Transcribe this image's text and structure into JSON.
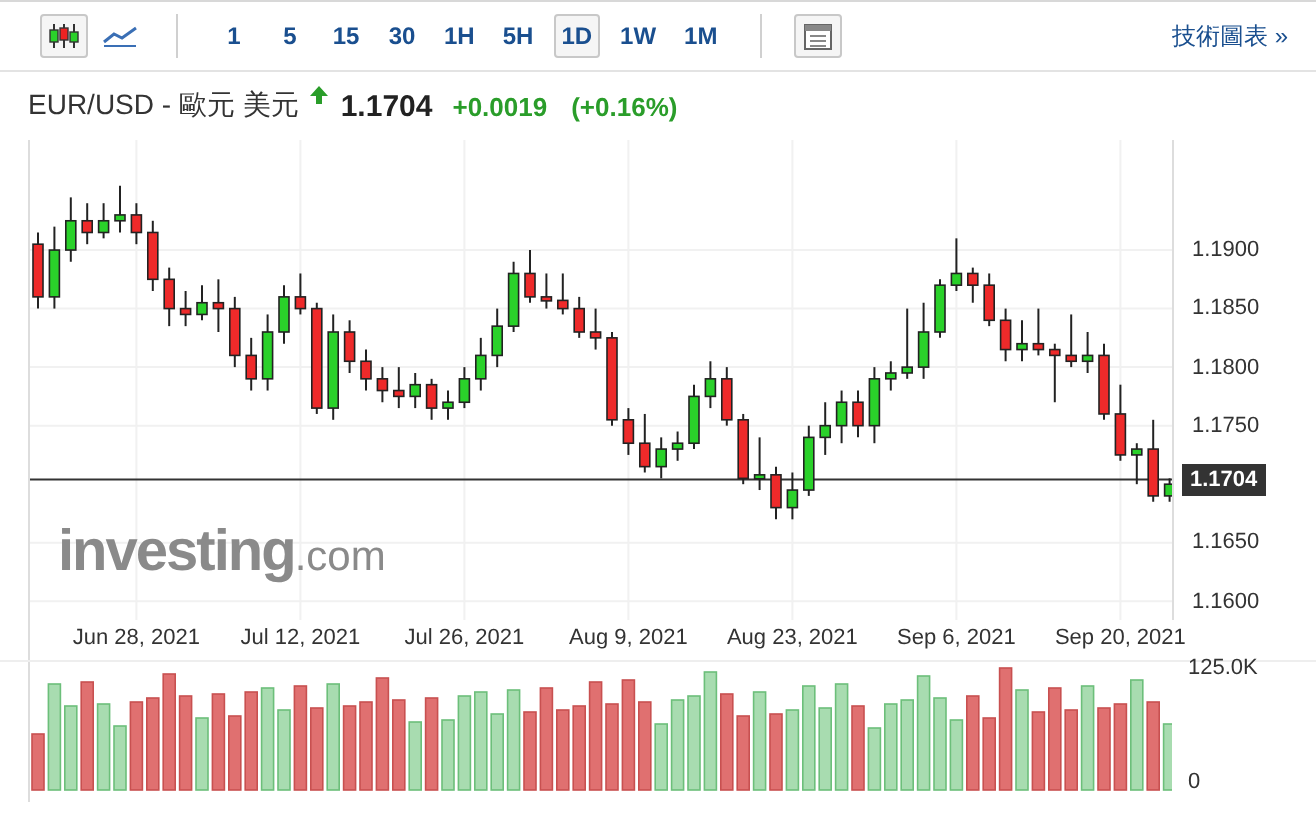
{
  "toolbar": {
    "chart_types": [
      {
        "kind": "candlestick",
        "selected": true
      },
      {
        "kind": "line",
        "selected": false
      }
    ],
    "intervals": [
      {
        "label": "1",
        "selected": false
      },
      {
        "label": "5",
        "selected": false
      },
      {
        "label": "15",
        "selected": false
      },
      {
        "label": "30",
        "selected": false
      },
      {
        "label": "1H",
        "selected": false
      },
      {
        "label": "5H",
        "selected": false
      },
      {
        "label": "1D",
        "selected": true
      },
      {
        "label": "1W",
        "selected": false
      },
      {
        "label": "1M",
        "selected": false
      }
    ],
    "link": "技術圖表 »"
  },
  "header": {
    "symbol": "EUR/USD - 歐元 美元",
    "up": true,
    "price": "1.1704",
    "change": "+0.0019",
    "change_percent": "(+0.16%)"
  },
  "chart": {
    "logo": {
      "name": "investing",
      "suffix": ".com"
    },
    "volume_labels": {
      "max": "125.0K",
      "min": "0"
    },
    "chart_data": {
      "type": "candlestick",
      "categories": [
        null,
        null,
        null,
        null,
        null,
        null,
        "Jun 28, 2021",
        null,
        null,
        null,
        null,
        null,
        null,
        null,
        null,
        null,
        "Jul 12, 2021",
        null,
        null,
        null,
        null,
        null,
        null,
        null,
        null,
        null,
        "Jul 26, 2021",
        null,
        null,
        null,
        null,
        null,
        null,
        null,
        null,
        null,
        "Aug 9, 2021",
        null,
        null,
        null,
        null,
        null,
        null,
        null,
        null,
        null,
        "Aug 23, 2021",
        null,
        null,
        null,
        null,
        null,
        null,
        null,
        null,
        null,
        "Sep 6, 2021",
        null,
        null,
        null,
        null,
        null,
        null,
        null,
        null,
        null,
        "Sep 20, 2021",
        null,
        null,
        null
      ],
      "ylim": [
        1.1584,
        1.1994
      ],
      "grid": true,
      "ref_lines": [
        {
          "axis": "y",
          "value": 1.1704,
          "label": "1.1704"
        }
      ],
      "yticks": [
        {
          "value": 1.19,
          "label": "1.1900"
        },
        {
          "value": 1.185,
          "label": "1.1850"
        },
        {
          "value": 1.18,
          "label": "1.1800"
        },
        {
          "value": 1.175,
          "label": "1.1750"
        },
        {
          "value": 1.165,
          "label": "1.1650"
        },
        {
          "value": 1.16,
          "label": "1.1600"
        }
      ],
      "ohlc": [
        [
          1.1905,
          1.1915,
          1.185,
          1.186
        ],
        [
          1.186,
          1.192,
          1.185,
          1.19
        ],
        [
          1.19,
          1.1945,
          1.189,
          1.1925
        ],
        [
          1.1925,
          1.194,
          1.1905,
          1.1915
        ],
        [
          1.1915,
          1.194,
          1.191,
          1.1925
        ],
        [
          1.1925,
          1.1955,
          1.1915,
          1.193
        ],
        [
          1.193,
          1.194,
          1.1905,
          1.1915
        ],
        [
          1.1915,
          1.1925,
          1.1865,
          1.1875
        ],
        [
          1.1875,
          1.1885,
          1.1835,
          1.185
        ],
        [
          1.185,
          1.1865,
          1.1835,
          1.1845
        ],
        [
          1.1845,
          1.187,
          1.184,
          1.1855
        ],
        [
          1.1855,
          1.1875,
          1.183,
          1.185
        ],
        [
          1.185,
          1.186,
          1.18,
          1.181
        ],
        [
          1.181,
          1.1825,
          1.178,
          1.179
        ],
        [
          1.179,
          1.1845,
          1.178,
          1.183
        ],
        [
          1.183,
          1.187,
          1.182,
          1.186
        ],
        [
          1.186,
          1.188,
          1.1845,
          1.185
        ],
        [
          1.185,
          1.1855,
          1.176,
          1.1765
        ],
        [
          1.1765,
          1.1845,
          1.1755,
          1.183
        ],
        [
          1.183,
          1.184,
          1.1795,
          1.1805
        ],
        [
          1.1805,
          1.1815,
          1.178,
          1.179
        ],
        [
          1.179,
          1.18,
          1.177,
          1.178
        ],
        [
          1.178,
          1.18,
          1.1765,
          1.1775
        ],
        [
          1.1775,
          1.1795,
          1.1765,
          1.1785
        ],
        [
          1.1785,
          1.179,
          1.1755,
          1.1765
        ],
        [
          1.1765,
          1.178,
          1.1755,
          1.177
        ],
        [
          1.177,
          1.18,
          1.1765,
          1.179
        ],
        [
          1.179,
          1.1825,
          1.178,
          1.181
        ],
        [
          1.181,
          1.185,
          1.18,
          1.1835
        ],
        [
          1.1835,
          1.189,
          1.183,
          1.188
        ],
        [
          1.188,
          1.19,
          1.1855,
          1.186
        ],
        [
          1.186,
          1.188,
          1.185,
          1.1857
        ],
        [
          1.1857,
          1.188,
          1.1845,
          1.185
        ],
        [
          1.185,
          1.186,
          1.1825,
          1.183
        ],
        [
          1.183,
          1.185,
          1.1815,
          1.1825
        ],
        [
          1.1825,
          1.183,
          1.175,
          1.1755
        ],
        [
          1.1755,
          1.1765,
          1.1725,
          1.1735
        ],
        [
          1.1735,
          1.176,
          1.171,
          1.1715
        ],
        [
          1.1715,
          1.174,
          1.1705,
          1.173
        ],
        [
          1.173,
          1.1745,
          1.172,
          1.1735
        ],
        [
          1.1735,
          1.1785,
          1.173,
          1.1775
        ],
        [
          1.1775,
          1.1805,
          1.1765,
          1.179
        ],
        [
          1.179,
          1.18,
          1.175,
          1.1755
        ],
        [
          1.1755,
          1.176,
          1.17,
          1.1705
        ],
        [
          1.1705,
          1.174,
          1.1695,
          1.1708
        ],
        [
          1.1708,
          1.1715,
          1.167,
          1.168
        ],
        [
          1.168,
          1.171,
          1.167,
          1.1695
        ],
        [
          1.1695,
          1.175,
          1.169,
          1.174
        ],
        [
          1.174,
          1.177,
          1.1725,
          1.175
        ],
        [
          1.175,
          1.178,
          1.1735,
          1.177
        ],
        [
          1.177,
          1.178,
          1.174,
          1.175
        ],
        [
          1.175,
          1.18,
          1.1735,
          1.179
        ],
        [
          1.179,
          1.1805,
          1.178,
          1.1795
        ],
        [
          1.1795,
          1.185,
          1.179,
          1.18
        ],
        [
          1.18,
          1.1855,
          1.179,
          1.183
        ],
        [
          1.183,
          1.1875,
          1.1825,
          1.187
        ],
        [
          1.187,
          1.191,
          1.1865,
          1.188
        ],
        [
          1.188,
          1.1885,
          1.1855,
          1.187
        ],
        [
          1.187,
          1.188,
          1.1835,
          1.184
        ],
        [
          1.184,
          1.185,
          1.1805,
          1.1815
        ],
        [
          1.1815,
          1.184,
          1.1805,
          1.182
        ],
        [
          1.182,
          1.185,
          1.181,
          1.1815
        ],
        [
          1.1815,
          1.182,
          1.177,
          1.181
        ],
        [
          1.181,
          1.1845,
          1.18,
          1.1805
        ],
        [
          1.1805,
          1.183,
          1.1795,
          1.181
        ],
        [
          1.181,
          1.182,
          1.1755,
          1.176
        ],
        [
          1.176,
          1.1785,
          1.172,
          1.1725
        ],
        [
          1.1725,
          1.1735,
          1.17,
          1.173
        ],
        [
          1.173,
          1.1755,
          1.1685,
          1.169
        ],
        [
          1.169,
          1.1705,
          1.1685,
          1.17
        ]
      ]
    }
  }
}
